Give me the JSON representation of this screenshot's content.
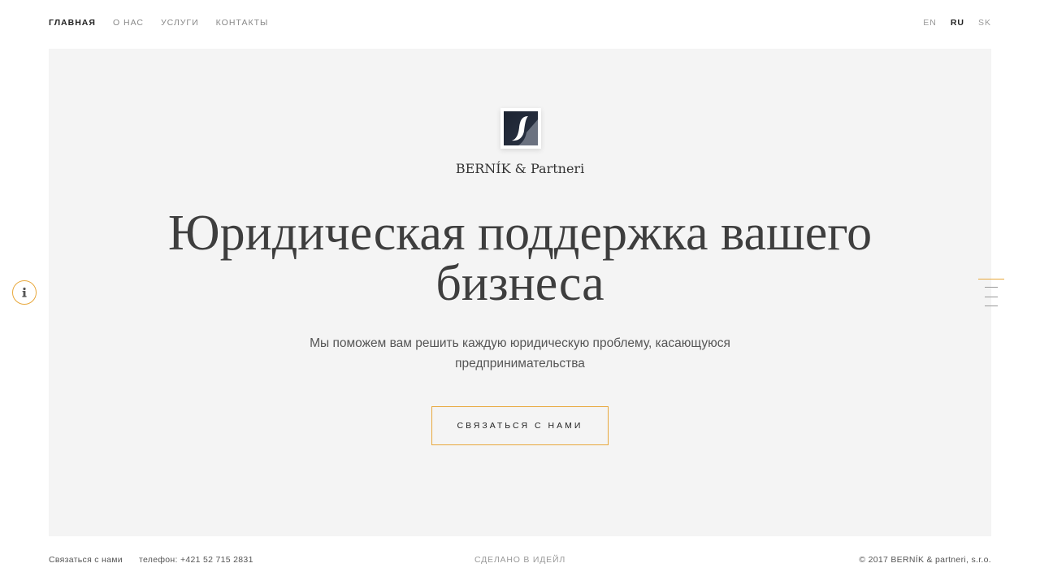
{
  "nav": {
    "items": [
      {
        "label": "ГЛАВНАЯ",
        "active": true
      },
      {
        "label": "О НАС",
        "active": false
      },
      {
        "label": "УСЛУГИ",
        "active": false
      },
      {
        "label": "КОНТАКТЫ",
        "active": false
      }
    ]
  },
  "languages": {
    "items": [
      {
        "label": "EN",
        "active": false
      },
      {
        "label": "RU",
        "active": true
      },
      {
        "label": "SK",
        "active": false
      }
    ]
  },
  "hero": {
    "logo_icon": "stylized-s-logo-icon",
    "brand_name": "BERNÍK & Partneri",
    "title": "Юридическая поддержка вашего бизнеса",
    "subtitle": "Мы поможем вам решить каждую юридическую проблему, касающуюся предпринимательства",
    "cta_label": "СВЯЗАТЬСЯ С НАМИ",
    "background_color": "#f4f4f4"
  },
  "side": {
    "info_icon": "info-icon",
    "menu_icon": "hamburger-menu-icon"
  },
  "footer": {
    "contact_label": "Связаться с нами",
    "phone": "телефон: +421 52 715 2831",
    "made_by": "СДЕЛАНО В ИДЕЙЛ",
    "copyright": "© 2017 BERNÍK & partneri, s.r.o."
  },
  "colors": {
    "accent": "#e8a83c",
    "text_dark": "#3e3e3e",
    "logo_dark": "#1c2331"
  }
}
